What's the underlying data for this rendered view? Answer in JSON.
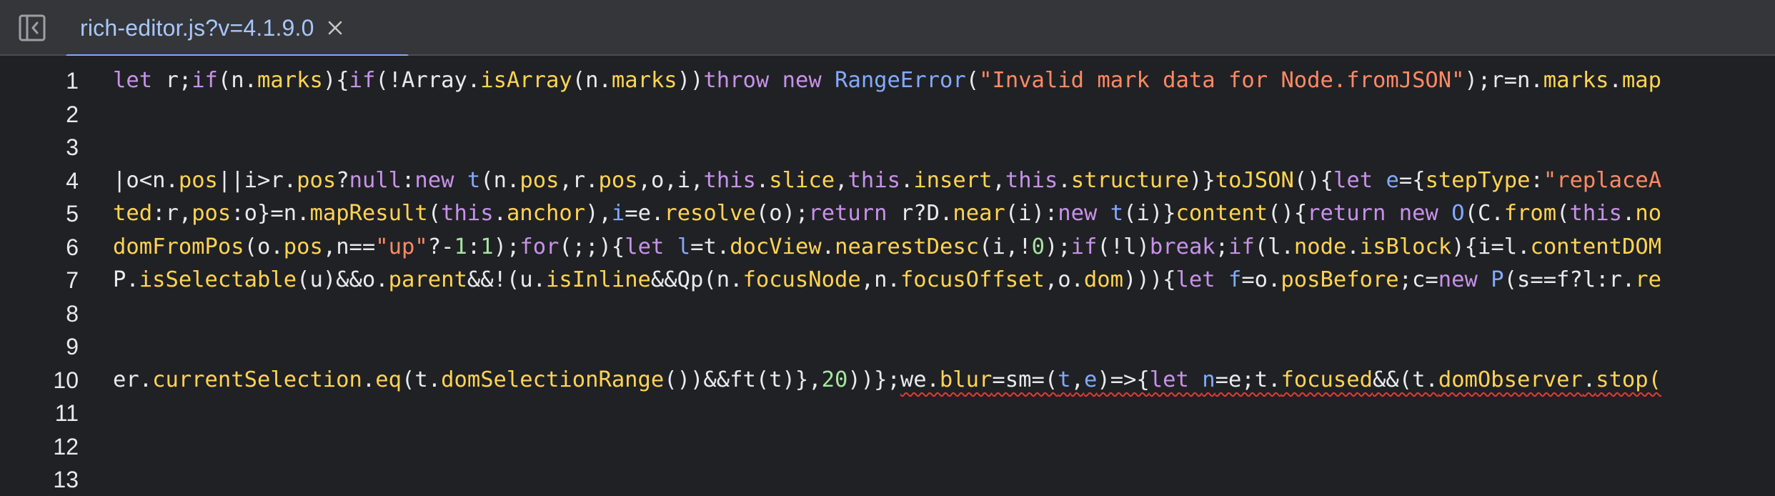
{
  "colors": {
    "keyword": "#c792ea",
    "keyword_blue": "#7b8cff",
    "property": "#ffd452",
    "string": "#ff8a65",
    "number": "#a5e4a1",
    "plain": "#e8eaed",
    "class": "#82aaff",
    "tab_label": "#a8c7fa"
  },
  "tabbar": {
    "sidebar_icon": "sidebar-toggle-icon",
    "tab": {
      "label": "rich-editor.js?v=4.1.9.0",
      "close_icon": "close-icon"
    }
  },
  "editor": {
    "lines": [
      {
        "number": "1",
        "tokens": [
          {
            "t": "let",
            "c": "keyword"
          },
          {
            "t": " r;",
            "c": "plain"
          },
          {
            "t": "if",
            "c": "keyword"
          },
          {
            "t": "(n.",
            "c": "plain"
          },
          {
            "t": "marks",
            "c": "property"
          },
          {
            "t": "){",
            "c": "plain"
          },
          {
            "t": "if",
            "c": "keyword"
          },
          {
            "t": "(!Array.",
            "c": "plain"
          },
          {
            "t": "isArray",
            "c": "property"
          },
          {
            "t": "(n.",
            "c": "plain"
          },
          {
            "t": "marks",
            "c": "property"
          },
          {
            "t": "))",
            "c": "plain"
          },
          {
            "t": "throw",
            "c": "keyword"
          },
          {
            "t": " ",
            "c": "plain"
          },
          {
            "t": "new",
            "c": "keyword"
          },
          {
            "t": " ",
            "c": "plain"
          },
          {
            "t": "RangeError",
            "c": "class"
          },
          {
            "t": "(",
            "c": "plain"
          },
          {
            "t": "\"Invalid mark data for Node.fromJSON\"",
            "c": "string"
          },
          {
            "t": ");r=n.",
            "c": "plain"
          },
          {
            "t": "marks",
            "c": "property"
          },
          {
            "t": ".",
            "c": "plain"
          },
          {
            "t": "map",
            "c": "property"
          }
        ]
      },
      {
        "number": "2",
        "tokens": []
      },
      {
        "number": "3",
        "tokens": []
      },
      {
        "number": "4",
        "tokens": [
          {
            "t": "|o<n.",
            "c": "plain"
          },
          {
            "t": "pos",
            "c": "property"
          },
          {
            "t": "||i>r.",
            "c": "plain"
          },
          {
            "t": "pos",
            "c": "property"
          },
          {
            "t": "?",
            "c": "plain"
          },
          {
            "t": "null",
            "c": "keyword"
          },
          {
            "t": ":",
            "c": "plain"
          },
          {
            "t": "new",
            "c": "keyword"
          },
          {
            "t": " ",
            "c": "plain"
          },
          {
            "t": "t",
            "c": "class"
          },
          {
            "t": "(n.",
            "c": "plain"
          },
          {
            "t": "pos",
            "c": "property"
          },
          {
            "t": ",r.",
            "c": "plain"
          },
          {
            "t": "pos",
            "c": "property"
          },
          {
            "t": ",o,i,",
            "c": "plain"
          },
          {
            "t": "this",
            "c": "keyword"
          },
          {
            "t": ".",
            "c": "plain"
          },
          {
            "t": "slice",
            "c": "property"
          },
          {
            "t": ",",
            "c": "plain"
          },
          {
            "t": "this",
            "c": "keyword"
          },
          {
            "t": ".",
            "c": "plain"
          },
          {
            "t": "insert",
            "c": "property"
          },
          {
            "t": ",",
            "c": "plain"
          },
          {
            "t": "this",
            "c": "keyword"
          },
          {
            "t": ".",
            "c": "plain"
          },
          {
            "t": "structure",
            "c": "property"
          },
          {
            "t": ")}",
            "c": "plain"
          },
          {
            "t": "toJSON",
            "c": "property"
          },
          {
            "t": "(){",
            "c": "plain"
          },
          {
            "t": "let",
            "c": "keyword"
          },
          {
            "t": " ",
            "c": "plain"
          },
          {
            "t": "e",
            "c": "class"
          },
          {
            "t": "={",
            "c": "plain"
          },
          {
            "t": "stepType",
            "c": "property"
          },
          {
            "t": ":",
            "c": "plain"
          },
          {
            "t": "\"replaceA",
            "c": "string"
          }
        ]
      },
      {
        "number": "5",
        "tokens": [
          {
            "t": "ted",
            "c": "property"
          },
          {
            "t": ":r,",
            "c": "plain"
          },
          {
            "t": "pos",
            "c": "property"
          },
          {
            "t": ":o}=n.",
            "c": "plain"
          },
          {
            "t": "mapResult",
            "c": "property"
          },
          {
            "t": "(",
            "c": "plain"
          },
          {
            "t": "this",
            "c": "keyword"
          },
          {
            "t": ".",
            "c": "plain"
          },
          {
            "t": "anchor",
            "c": "property"
          },
          {
            "t": "),",
            "c": "plain"
          },
          {
            "t": "i",
            "c": "class"
          },
          {
            "t": "=e.",
            "c": "plain"
          },
          {
            "t": "resolve",
            "c": "property"
          },
          {
            "t": "(o);",
            "c": "plain"
          },
          {
            "t": "return",
            "c": "keyword"
          },
          {
            "t": " r?D.",
            "c": "plain"
          },
          {
            "t": "near",
            "c": "property"
          },
          {
            "t": "(i):",
            "c": "plain"
          },
          {
            "t": "new",
            "c": "keyword"
          },
          {
            "t": " ",
            "c": "plain"
          },
          {
            "t": "t",
            "c": "class"
          },
          {
            "t": "(i)}",
            "c": "plain"
          },
          {
            "t": "content",
            "c": "property"
          },
          {
            "t": "(){",
            "c": "plain"
          },
          {
            "t": "return",
            "c": "keyword"
          },
          {
            "t": " ",
            "c": "plain"
          },
          {
            "t": "new",
            "c": "keyword"
          },
          {
            "t": " ",
            "c": "plain"
          },
          {
            "t": "O",
            "c": "class"
          },
          {
            "t": "(C.",
            "c": "plain"
          },
          {
            "t": "from",
            "c": "property"
          },
          {
            "t": "(",
            "c": "plain"
          },
          {
            "t": "this",
            "c": "keyword"
          },
          {
            "t": ".",
            "c": "plain"
          },
          {
            "t": "no",
            "c": "property"
          }
        ]
      },
      {
        "number": "6",
        "tokens": [
          {
            "t": "domFromPos",
            "c": "property"
          },
          {
            "t": "(o.",
            "c": "plain"
          },
          {
            "t": "pos",
            "c": "property"
          },
          {
            "t": ",n==",
            "c": "plain"
          },
          {
            "t": "\"up\"",
            "c": "string"
          },
          {
            "t": "?-",
            "c": "plain"
          },
          {
            "t": "1",
            "c": "number"
          },
          {
            "t": ":",
            "c": "plain"
          },
          {
            "t": "1",
            "c": "number"
          },
          {
            "t": ");",
            "c": "plain"
          },
          {
            "t": "for",
            "c": "keyword"
          },
          {
            "t": "(;;){",
            "c": "plain"
          },
          {
            "t": "let",
            "c": "keyword"
          },
          {
            "t": " ",
            "c": "plain"
          },
          {
            "t": "l",
            "c": "class"
          },
          {
            "t": "=t.",
            "c": "plain"
          },
          {
            "t": "docView",
            "c": "property"
          },
          {
            "t": ".",
            "c": "plain"
          },
          {
            "t": "nearestDesc",
            "c": "property"
          },
          {
            "t": "(i,!",
            "c": "plain"
          },
          {
            "t": "0",
            "c": "number"
          },
          {
            "t": ");",
            "c": "plain"
          },
          {
            "t": "if",
            "c": "keyword"
          },
          {
            "t": "(!l)",
            "c": "plain"
          },
          {
            "t": "break",
            "c": "keyword"
          },
          {
            "t": ";",
            "c": "plain"
          },
          {
            "t": "if",
            "c": "keyword"
          },
          {
            "t": "(l.",
            "c": "plain"
          },
          {
            "t": "node",
            "c": "property"
          },
          {
            "t": ".",
            "c": "plain"
          },
          {
            "t": "isBlock",
            "c": "property"
          },
          {
            "t": "){i=l.",
            "c": "plain"
          },
          {
            "t": "contentDOM",
            "c": "property"
          }
        ]
      },
      {
        "number": "7",
        "tokens": [
          {
            "t": "P.",
            "c": "plain"
          },
          {
            "t": "isSelectable",
            "c": "property"
          },
          {
            "t": "(u)&&o.",
            "c": "plain"
          },
          {
            "t": "parent",
            "c": "property"
          },
          {
            "t": "&&!(u.",
            "c": "plain"
          },
          {
            "t": "isInline",
            "c": "property"
          },
          {
            "t": "&&Qp(n.",
            "c": "plain"
          },
          {
            "t": "focusNode",
            "c": "property"
          },
          {
            "t": ",n.",
            "c": "plain"
          },
          {
            "t": "focusOffset",
            "c": "property"
          },
          {
            "t": ",o.",
            "c": "plain"
          },
          {
            "t": "dom",
            "c": "property"
          },
          {
            "t": "))){",
            "c": "plain"
          },
          {
            "t": "let",
            "c": "keyword"
          },
          {
            "t": " ",
            "c": "plain"
          },
          {
            "t": "f",
            "c": "class"
          },
          {
            "t": "=o.",
            "c": "plain"
          },
          {
            "t": "posBefore",
            "c": "property"
          },
          {
            "t": ";c=",
            "c": "plain"
          },
          {
            "t": "new",
            "c": "keyword"
          },
          {
            "t": " ",
            "c": "plain"
          },
          {
            "t": "P",
            "c": "class"
          },
          {
            "t": "(s==f?l:r.",
            "c": "plain"
          },
          {
            "t": "re",
            "c": "property"
          }
        ]
      },
      {
        "number": "8",
        "tokens": []
      },
      {
        "number": "9",
        "tokens": []
      },
      {
        "number": "10",
        "tokens": [
          {
            "t": "er.",
            "c": "plain"
          },
          {
            "t": "currentSelection",
            "c": "property"
          },
          {
            "t": ".",
            "c": "plain"
          },
          {
            "t": "eq",
            "c": "property"
          },
          {
            "t": "(t.",
            "c": "plain"
          },
          {
            "t": "domSelectionRange",
            "c": "property"
          },
          {
            "t": "())&&ft(t)},",
            "c": "plain"
          },
          {
            "t": "20",
            "c": "number"
          },
          {
            "t": "))};",
            "c": "plain"
          },
          {
            "t": "we.",
            "c": "plain",
            "sq": true
          },
          {
            "t": "blur",
            "c": "property",
            "sq": true
          },
          {
            "t": "=sm=(",
            "c": "plain",
            "sq": true
          },
          {
            "t": "t",
            "c": "class",
            "sq": true
          },
          {
            "t": ",",
            "c": "plain",
            "sq": true
          },
          {
            "t": "e",
            "c": "class",
            "sq": true
          },
          {
            "t": ")=>{",
            "c": "plain",
            "sq": true
          },
          {
            "t": "let",
            "c": "keyword",
            "sq": true
          },
          {
            "t": " ",
            "c": "plain",
            "sq": true
          },
          {
            "t": "n",
            "c": "class",
            "sq": true
          },
          {
            "t": "=e;t.",
            "c": "plain",
            "sq": true
          },
          {
            "t": "focused",
            "c": "property",
            "sq": true
          },
          {
            "t": "&&(t.",
            "c": "plain",
            "sq": true
          },
          {
            "t": "domObserver",
            "c": "property",
            "sq": true
          },
          {
            "t": ".",
            "c": "plain",
            "sq": true
          },
          {
            "t": "stop(",
            "c": "property",
            "sq": true
          }
        ]
      },
      {
        "number": "11",
        "tokens": []
      },
      {
        "number": "12",
        "tokens": []
      },
      {
        "number": "13",
        "tokens": []
      }
    ]
  }
}
